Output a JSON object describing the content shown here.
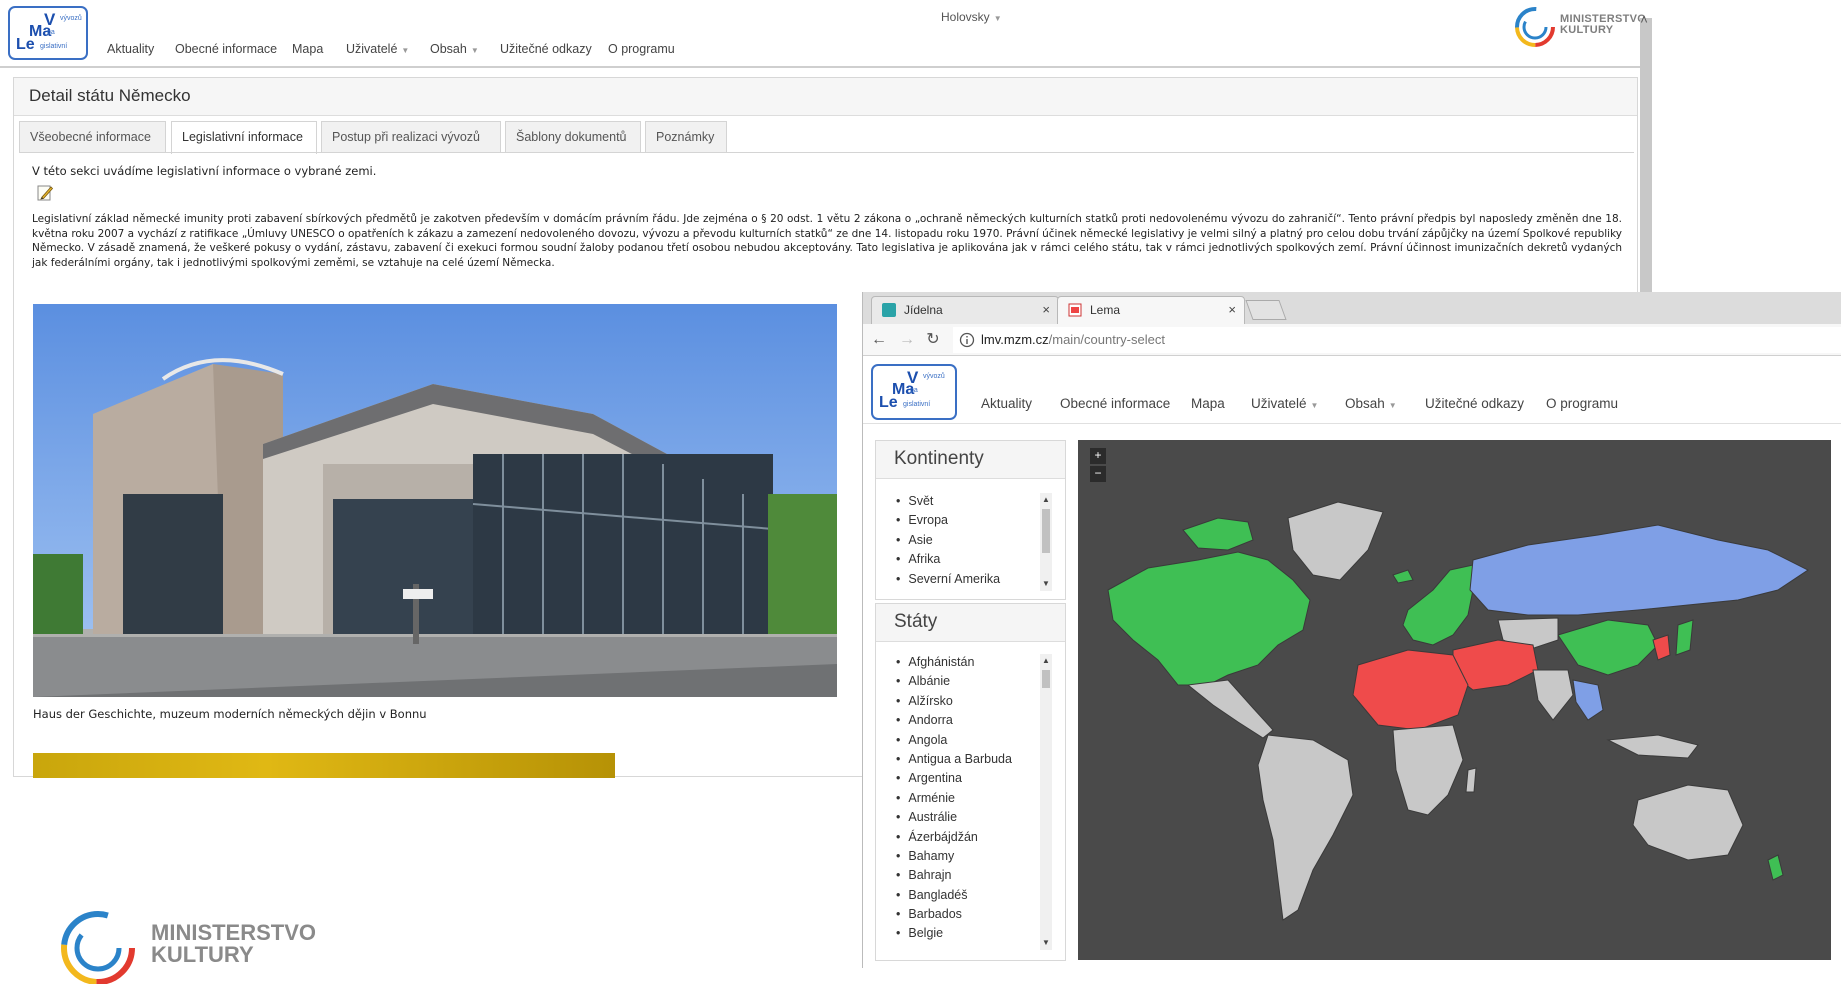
{
  "app": {
    "logo": {
      "v": "V",
      "vyvozu": "vývozů",
      "ma": "Ma",
      "pa": "pa",
      "le": "Le",
      "gislativni": "gislativní"
    },
    "nav": [
      "Aktuality",
      "Obecné informace",
      "Mapa",
      "Uživatelé",
      "Obsah",
      "Užitečné odkazy",
      "O programu"
    ],
    "user": "Holovsky",
    "ministry": {
      "line1": "MINISTERSTVO",
      "line2": "KULTURY"
    },
    "panel_title": "Detail státu Německo",
    "tabs": [
      "Všeobecné informace",
      "Legislativní informace",
      "Postup při realizaci vývozů",
      "Šablony dokumentů",
      "Poznámky"
    ],
    "active_tab": "Legislativní informace",
    "intro": "V této sekci uvádíme legislativní informace o vybrané zemi.",
    "paragraph": "Legislativní základ německé imunity proti zabavení sbírkových předmětů je zakotven především v domácím právním řádu. Jde zejména o § 20 odst. 1 větu 2 zákona o „ochraně německých kulturních statků proti nedovolenému vývozu do zahraničí“. Tento právní předpis byl naposledy změněn dne 18. května roku 2007 a vychází z ratifikace „Úmluvy UNESCO o opatřeních k zákazu a zamezení nedovoleného dovozu, vývozu a převodu kulturních statků“ ze dne 14. listopadu roku 1970. Právní účinek německé legislativy je velmi silný a platný pro celou dobu trvání zápůjčky na území Spolkové republiky Německo. V zásadě znamená, že veškeré pokusy o vydání, zástavu, zabavení či exekuci formou soudní žaloby podanou třetí osobou nebudou akceptovány. Tato legislativa je aplikována jak v rámci celého státu, tak v rámci jednotlivých spolkových zemí. Právní účinnost imunizačních dekretů vydaných jak federálními orgány, tak i jednotlivými spolkovými zeměmi, se vztahuje na celé území Německa.",
    "caption": "Haus der Geschichte, muzeum moderních německých dějin v Bonnu"
  },
  "bottom_logo": {
    "line1": "MINISTERSTVO",
    "line2": "KULTURY"
  },
  "browser": {
    "tabs": [
      {
        "label": "Jídelna",
        "close": "×"
      },
      {
        "label": "Lema",
        "close": "×"
      }
    ],
    "url_host": "lmv.mzm.cz",
    "url_path": "/main/country-select",
    "nav": [
      "Aktuality",
      "Obecné informace",
      "Mapa",
      "Uživatelé",
      "Obsah",
      "Užitečné odkazy",
      "O programu"
    ],
    "continents_title": "Kontinenty",
    "continents": [
      "Svět",
      "Evropa",
      "Asie",
      "Afrika",
      "Severní Amerika"
    ],
    "states_title": "Státy",
    "states": [
      "Afghánistán",
      "Albánie",
      "Alžírsko",
      "Andorra",
      "Angola",
      "Antigua a Barbuda",
      "Argentina",
      "Arménie",
      "Austrálie",
      "Ázerbájdžán",
      "Bahamy",
      "Bahrajn",
      "Bangladéš",
      "Barbados",
      "Belgie"
    ],
    "map": {
      "zoom_in": "+",
      "zoom_out": "−",
      "colors": {
        "background": "#4a4a4a",
        "land": "#c8c8c8",
        "green": "#3fbf54",
        "red": "#ef4b4b",
        "blue": "#7f9fe6"
      }
    }
  },
  "colors": {
    "accent": "#1c4fae",
    "panel_border": "#d7d7d7"
  }
}
